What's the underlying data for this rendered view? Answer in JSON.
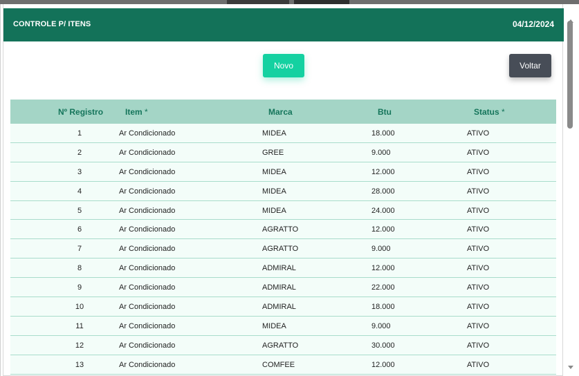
{
  "header": {
    "title": "CONTROLE P/ ITENS",
    "date": "04/12/2024"
  },
  "buttons": {
    "novo": "Novo",
    "voltar": "Voltar"
  },
  "table": {
    "columns": [
      "Nº Registro",
      "Item",
      "Marca",
      "Btu",
      "Status"
    ],
    "required_mark": "*",
    "rows": [
      [
        "1",
        "Ar Condicionado",
        "MIDEA",
        "18.000",
        "ATIVO"
      ],
      [
        "2",
        "Ar Condicionado",
        "GREE",
        "9.000",
        "ATIVO"
      ],
      [
        "3",
        "Ar Condicionado",
        "MIDEA",
        "12.000",
        "ATIVO"
      ],
      [
        "4",
        "Ar Condicionado",
        "MIDEA",
        "28.000",
        "ATIVO"
      ],
      [
        "5",
        "Ar Condicionado",
        "MIDEA",
        "24.000",
        "ATIVO"
      ],
      [
        "6",
        "Ar Condicionado",
        "AGRATTO",
        "12.000",
        "ATIVO"
      ],
      [
        "7",
        "Ar Condicionado",
        "AGRATTO",
        "9.000",
        "ATIVO"
      ],
      [
        "8",
        "Ar Condicionado",
        "ADMIRAL",
        "12.000",
        "ATIVO"
      ],
      [
        "9",
        "Ar Condicionado",
        "ADMIRAL",
        "22.000",
        "ATIVO"
      ],
      [
        "10",
        "Ar Condicionado",
        "ADMIRAL",
        "18.000",
        "ATIVO"
      ],
      [
        "11",
        "Ar Condicionado",
        "MIDEA",
        "9.000",
        "ATIVO"
      ],
      [
        "12",
        "Ar Condicionado",
        "AGRATTO",
        "30.000",
        "ATIVO"
      ],
      [
        "13",
        "Ar Condicionado",
        "COMFEE",
        "12.000",
        "ATIVO"
      ]
    ]
  },
  "colors": {
    "header": "#137259",
    "novo_button": "#14d1a1",
    "voltar_button": "#474d57",
    "table_head": "#a4d5c6",
    "row_bg": "#f3fdf9"
  }
}
